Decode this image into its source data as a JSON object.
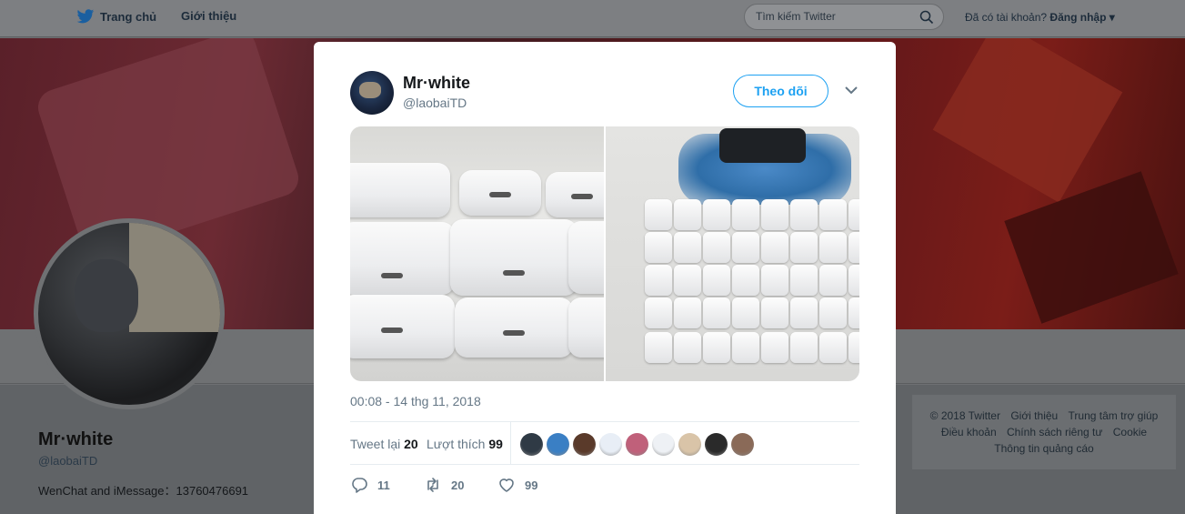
{
  "nav": {
    "home_label": "Trang chủ",
    "about_label": "Giới thiệu",
    "search_placeholder": "Tìm kiếm Twitter",
    "login_prompt": "Đã có tài khoản?",
    "login_label": "Đăng nhập"
  },
  "profile": {
    "name": "Mr·white",
    "handle": "@laobaiTD",
    "bio": "WenChat and iMessage：13760476691"
  },
  "footer": {
    "links": [
      "© 2018 Twitter",
      "Giới thiệu",
      "Trung tâm trợ giúp",
      "Điều khoản",
      "Chính sách riêng tư",
      "Cookie",
      "Thông tin quảng cáo"
    ]
  },
  "tweet": {
    "author_name": "Mr·white",
    "author_handle": "@laobaiTD",
    "follow_label": "Theo dõi",
    "timestamp": "00:08 - 14 thg 11, 2018",
    "retweets_label": "Tweet lại",
    "retweets_count": "20",
    "likes_label": "Lượt thích",
    "likes_count": "99",
    "actions": {
      "reply_count": "11",
      "retweet_count": "20",
      "like_count": "99"
    },
    "liker_colors": [
      "#2f3a45",
      "#3a7fc4",
      "#5a3a2a",
      "#e8eef6",
      "#c0607a",
      "#eef1f5",
      "#d9c4a8",
      "#2a2a2a",
      "#8a6a58"
    ]
  },
  "colors": {
    "accent": "#1da1f2",
    "muted": "#657786"
  }
}
